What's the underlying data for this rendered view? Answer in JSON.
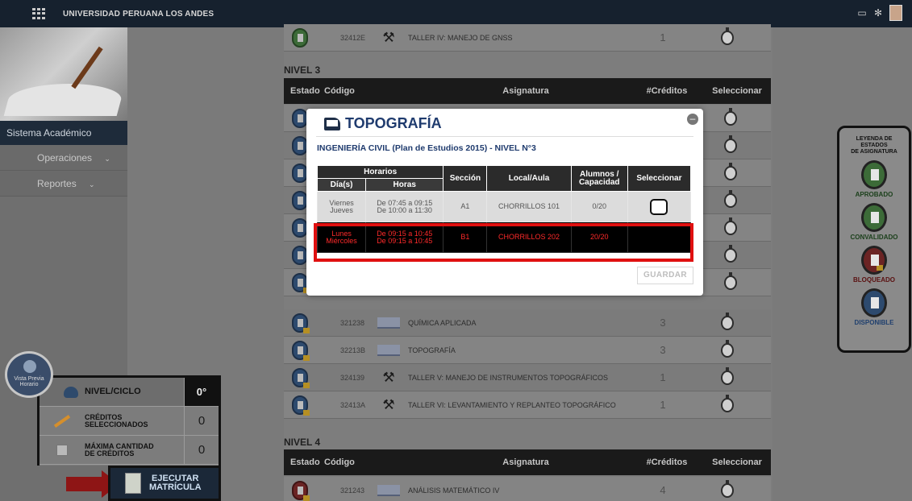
{
  "topbar": {
    "brand": "UNIVERSIDAD PERUANA LOS ANDES"
  },
  "sidebar": {
    "title": "Sistema Académico",
    "items": [
      {
        "label": "Operaciones"
      },
      {
        "label": "Reportes"
      }
    ]
  },
  "levels": {
    "nivel3": "NIVEL 3",
    "nivel4": "NIVEL 4"
  },
  "table_headers": {
    "estado": "Estado",
    "codigo": "Código",
    "asignatura": "Asignatura",
    "creditos": "#Créditos",
    "seleccionar": "Seleccionar"
  },
  "courses_top": [
    {
      "code": "32412E",
      "name": "TALLER IV: MANEJO DE GNSS",
      "credits": "1"
    }
  ],
  "courses_nivel3": [
    {
      "code": "321238",
      "name": "QUÍMICA APLICADA",
      "credits": "3"
    },
    {
      "code": "32213B",
      "name": "TOPOGRAFÍA",
      "credits": "3"
    },
    {
      "code": "324139",
      "name": "TALLER V: MANEJO DE INSTRUMENTOS TOPOGRÁFICOS",
      "credits": "1"
    },
    {
      "code": "32413A",
      "name": "TALLER VI: LEVANTAMIENTO Y REPLANTEO TOPOGRÁFICO",
      "credits": "1"
    }
  ],
  "courses_nivel4": [
    {
      "code": "321243",
      "name": "ANÁLISIS MATEMÁTICO IV",
      "credits": "4"
    }
  ],
  "modal": {
    "title": "TOPOGRAFÍA",
    "subtitle": "INGENIERÍA CIVIL (Plan de Estudios 2015) - NIVEL N°3",
    "headers": {
      "horarios": "Horarios",
      "dias": "Día(s)",
      "horas": "Horas",
      "seccion": "Sección",
      "local": "Local/Aula",
      "alumnos_1": "Alumnos /",
      "alumnos_2": "Capacidad",
      "seleccionar": "Seleccionar"
    },
    "rows": [
      {
        "dia1": "Viernes",
        "dia2": "Jueves",
        "hora1": "De 07:45 a 09:15",
        "hora2": "De 10:00 a 11:30",
        "seccion": "A1",
        "local": "CHORRILLOS 101",
        "alumnos": "0/20"
      },
      {
        "dia1": "Lunes",
        "dia2": "Miércoles",
        "hora1": "De 09:15 a 10:45",
        "hora2": "De 09:15 a 10:45",
        "seccion": "B1",
        "local": "CHORRILLOS 202",
        "alumnos": "20/20"
      }
    ],
    "save_label": "GUARDAR"
  },
  "legend": {
    "title_1": "LEYENDA DE",
    "title_2": "ESTADOS",
    "title_3": "DE ASIGNATURA",
    "items": [
      {
        "label": "APROBADO",
        "color": "#3c6b38"
      },
      {
        "label": "CONVALIDADO",
        "color": "#3c6b38"
      },
      {
        "label": "BLOQUEADO",
        "color": "#6b2424"
      },
      {
        "label": "DISPONIBLE",
        "color": "#2d4a6e"
      }
    ],
    "label_color": "#1f3f6e"
  },
  "summary": {
    "nivel_label": "NIVEL/CICLO",
    "nivel_value": "0°",
    "creditos_1": "CRÉDITOS",
    "creditos_2": "SELECCIONADOS",
    "creditos_value": "0",
    "maxima_1": "MÁXIMA CANTIDAD",
    "maxima_2": "DE CRÉDITOS",
    "maxima_value": "0",
    "preview_1": "Vista Previa",
    "preview_2": "Horario"
  },
  "execute": {
    "line1": "EJECUTAR",
    "line2": "MATRÍCULA"
  },
  "icons": {
    "grid": "grid-icon",
    "chat": "chat-icon",
    "settings": "gear-icon",
    "user": "avatar"
  }
}
